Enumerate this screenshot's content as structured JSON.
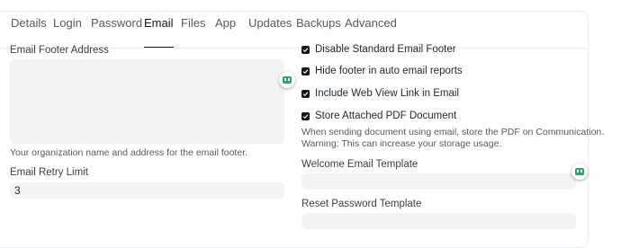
{
  "tabs": [
    {
      "label": "Details",
      "active": false
    },
    {
      "label": "Login",
      "active": false
    },
    {
      "label": "Password",
      "active": false
    },
    {
      "label": "Email",
      "active": true
    },
    {
      "label": "Files",
      "active": false
    },
    {
      "label": "App",
      "active": false
    },
    {
      "label": "Updates",
      "active": false
    },
    {
      "label": "Backups",
      "active": false
    },
    {
      "label": "Advanced",
      "active": false
    }
  ],
  "left": {
    "footer_address_label": "Email Footer Address",
    "footer_address_value": "",
    "footer_address_help": "Your organization name and address for the email footer.",
    "retry_limit_label": "Email Retry Limit",
    "retry_limit_value": "3"
  },
  "right": {
    "checkboxes": [
      {
        "label": "Disable Standard Email Footer",
        "checked": true
      },
      {
        "label": "Hide footer in auto email reports",
        "checked": true
      },
      {
        "label": "Include Web View Link in Email",
        "checked": true
      },
      {
        "label": "Store Attached PDF Document",
        "checked": true
      }
    ],
    "pdf_help_line1": "When sending document using email, store the PDF on Communication.",
    "pdf_help_line2": "Warning: This can increase your storage usage.",
    "welcome_template_label": "Welcome Email Template",
    "welcome_template_value": "",
    "reset_template_label": "Reset Password Template",
    "reset_template_value": ""
  },
  "icons": {
    "grammarly": "grammarly-icon",
    "check": "checkmark-icon"
  },
  "colors": {
    "accent": "#171717",
    "input_bg": "#f3f3f3",
    "grammarly_green": "#2fa36b"
  }
}
